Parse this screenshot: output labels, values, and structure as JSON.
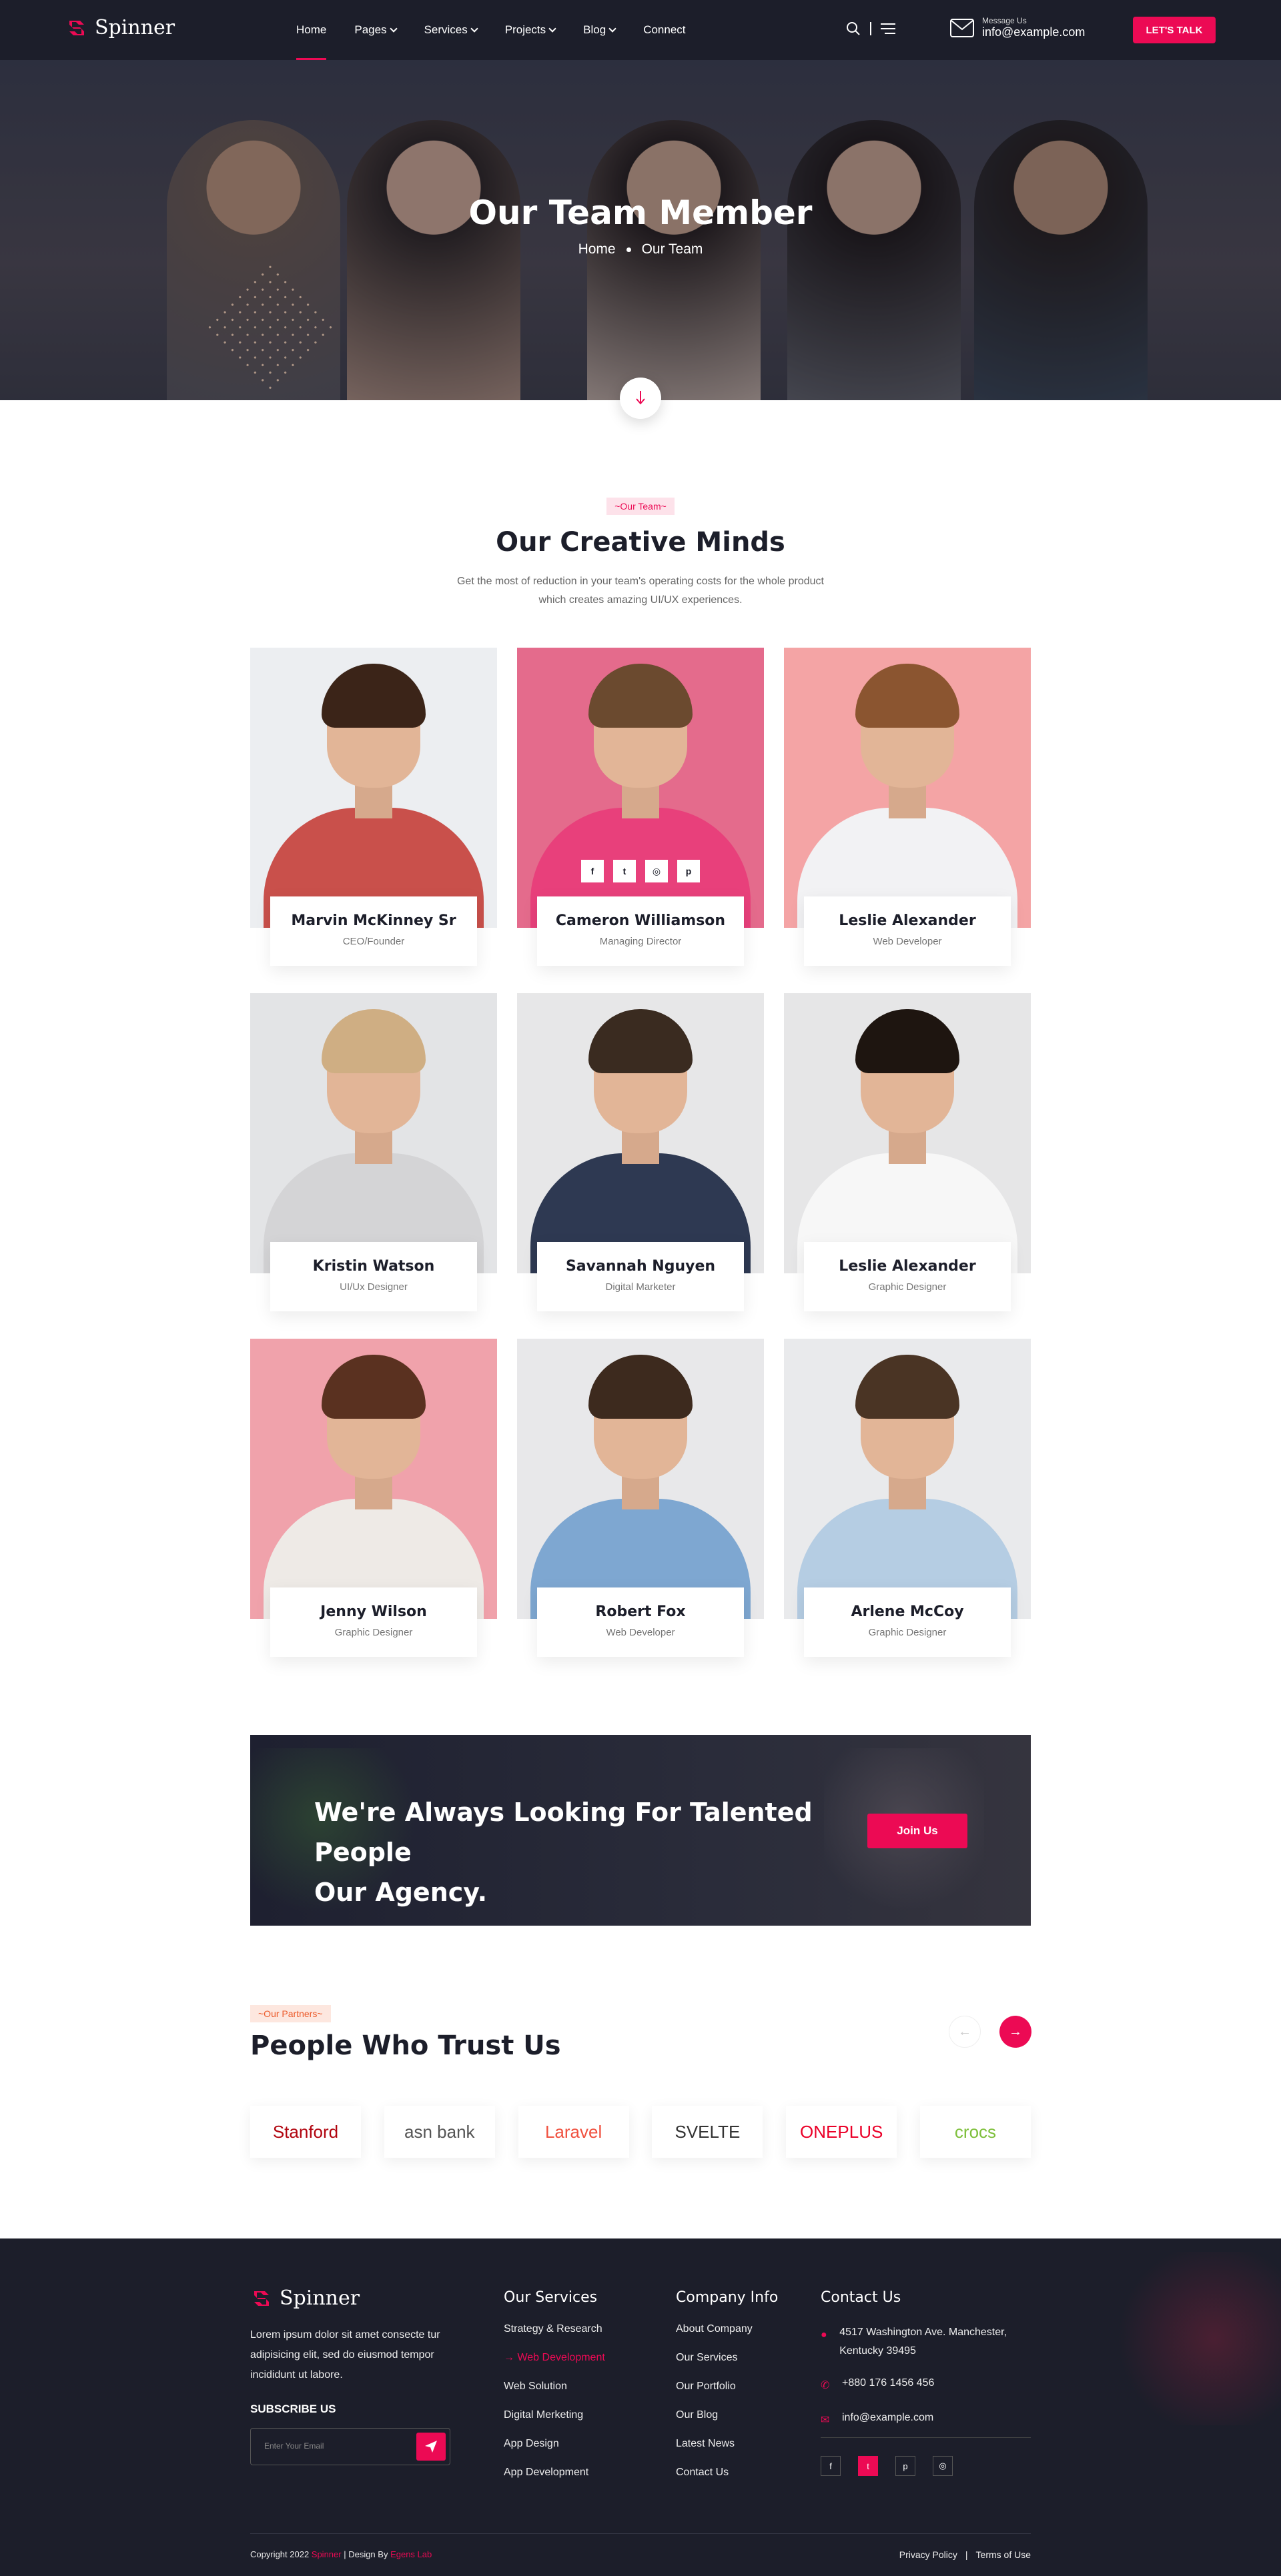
{
  "header": {
    "brand": "Spinner",
    "nav": [
      "Home",
      "Pages",
      "Services",
      "Projects",
      "Blog",
      "Connect"
    ],
    "nav_active": "Home",
    "message_label": "Message Us",
    "message_email": "info@example.com",
    "cta": "LET'S TALK"
  },
  "hero": {
    "title": "Our Team Member",
    "breadcrumb": [
      "Home",
      "Our Team"
    ]
  },
  "team": {
    "tag": "~Our Team~",
    "title": "Our Creative Minds",
    "description_line1": "Get the most of reduction in your team's operating costs for the whole product",
    "description_line2": "which creates amazing   UI/UX experiences.",
    "members": [
      {
        "name": "Marvin McKinney Sr",
        "role": "CEO/Founder",
        "bg": "#eceef1",
        "shirt": "#c9504b",
        "hair": "#3b2418"
      },
      {
        "name": "Cameron Williamson",
        "role": "Managing Director",
        "bg": "#e46b8c",
        "shirt": "#e8407b",
        "hair": "#6b4a2f"
      },
      {
        "name": "Leslie Alexander",
        "role": "Web Developer",
        "bg": "#f4a4a5",
        "shirt": "#f2f2f4",
        "hair": "#8b5530"
      },
      {
        "name": "Kristin Watson",
        "role": "UI/Ux Designer",
        "bg": "#e3e4e6",
        "shirt": "#d4d4d6",
        "hair": "#cfae83"
      },
      {
        "name": "Savannah Nguyen",
        "role": "Digital Marketer",
        "bg": "#e7e7e8",
        "shirt": "#2e3952",
        "hair": "#3a2b20"
      },
      {
        "name": "Leslie Alexander",
        "role": "Graphic Designer",
        "bg": "#e6e6e7",
        "shirt": "#f7f7f7",
        "hair": "#1e1510"
      },
      {
        "name": "Jenny Wilson",
        "role": "Graphic Designer",
        "bg": "#f0a2ab",
        "shirt": "#eeeae6",
        "hair": "#5a3120"
      },
      {
        "name": "Robert Fox",
        "role": "Web Developer",
        "bg": "#e8e8ea",
        "shirt": "#7ea7d1",
        "hair": "#3d2a1e"
      },
      {
        "name": "Arlene McCoy",
        "role": "Graphic Designer",
        "bg": "#e9eaec",
        "shirt": "#b5cde3",
        "hair": "#4a3424"
      }
    ],
    "hover_socials": [
      "f",
      "t",
      "ig",
      "p"
    ]
  },
  "banner": {
    "text_line1": "We're Always Looking For Talented People",
    "text_line2": "Our Agency.",
    "button": "Join Us"
  },
  "partners": {
    "tag": "~Our Partners~",
    "title": "People Who Trust Us",
    "logos": [
      {
        "label": "Stanford",
        "color": "#b1040e"
      },
      {
        "label": "asn bank",
        "color": "#555555"
      },
      {
        "label": "Laravel",
        "color": "#f0513f"
      },
      {
        "label": "SVELTE",
        "color": "#333333"
      },
      {
        "label": "ONEPLUS",
        "color": "#eb0028"
      },
      {
        "label": "crocs",
        "color": "#7dbf3a"
      }
    ]
  },
  "footer": {
    "brand": "Spinner",
    "about": "Lorem ipsum dolor sit amet consecte tur adipisicing elit, sed do eiusmod tempor incididunt ut labore.",
    "subscribe_label": "SUBSCRIBE US",
    "email_placeholder": "Enter Your Email",
    "services_title": "Our Services",
    "services": [
      "Strategy & Research",
      "Web Development",
      "Web Solution",
      "Digital Merketing",
      "App Design",
      "App Development"
    ],
    "services_active": "Web Development",
    "company_title": "Company Info",
    "company": [
      "About Company",
      "Our Services",
      "Our Portfolio",
      "Our Blog",
      "Latest News",
      "Contact Us"
    ],
    "contact_title": "Contact Us",
    "address": "4517 Washington Ave. Manchester, Kentucky 39495",
    "phone": "+880 176 1456 456",
    "email": "info@example.com",
    "copyright_prefix": "Copyright 2022 ",
    "copyright_brand": "Spinner",
    "copyright_mid": " | Design By ",
    "copyright_designer": "Egens Lab",
    "privacy": "Privacy Policy",
    "terms": "Terms of Use"
  },
  "colors": {
    "accent": "#ec0a54",
    "dark": "#1c1e2a"
  }
}
